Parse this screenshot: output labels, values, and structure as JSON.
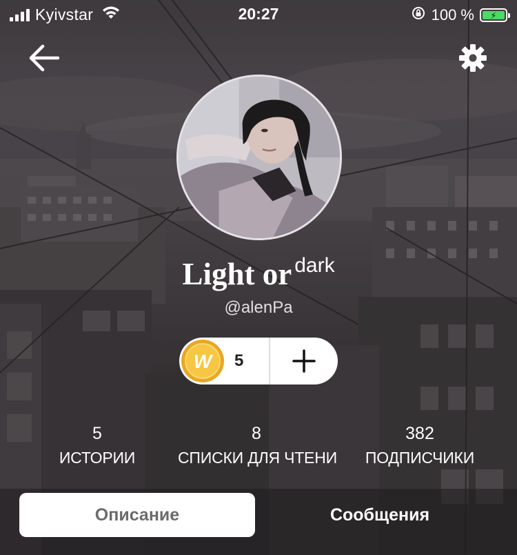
{
  "status_bar": {
    "carrier": "Kyivstar",
    "time": "20:27",
    "battery_percent": "100 %",
    "battery_color": "#4cd964"
  },
  "nav": {
    "back_icon": "arrow-left-icon",
    "settings_icon": "gear-icon"
  },
  "profile": {
    "name_main": "Light or",
    "name_sup": "dark",
    "handle": "@alenPa"
  },
  "coins": {
    "count": "5",
    "coin_letter": "W",
    "coin_color": "#f5b82e",
    "add_icon": "plus-icon"
  },
  "stats": [
    {
      "value": "5",
      "label": "ИСТОРИИ"
    },
    {
      "value": "8",
      "label": "СПИСКИ ДЛЯ ЧТЕНИ"
    },
    {
      "value": "382",
      "label": "ПОДПИСЧИКИ"
    }
  ],
  "tabs": [
    {
      "label": "Описание",
      "active": true
    },
    {
      "label": "Сообщения",
      "active": false
    }
  ]
}
